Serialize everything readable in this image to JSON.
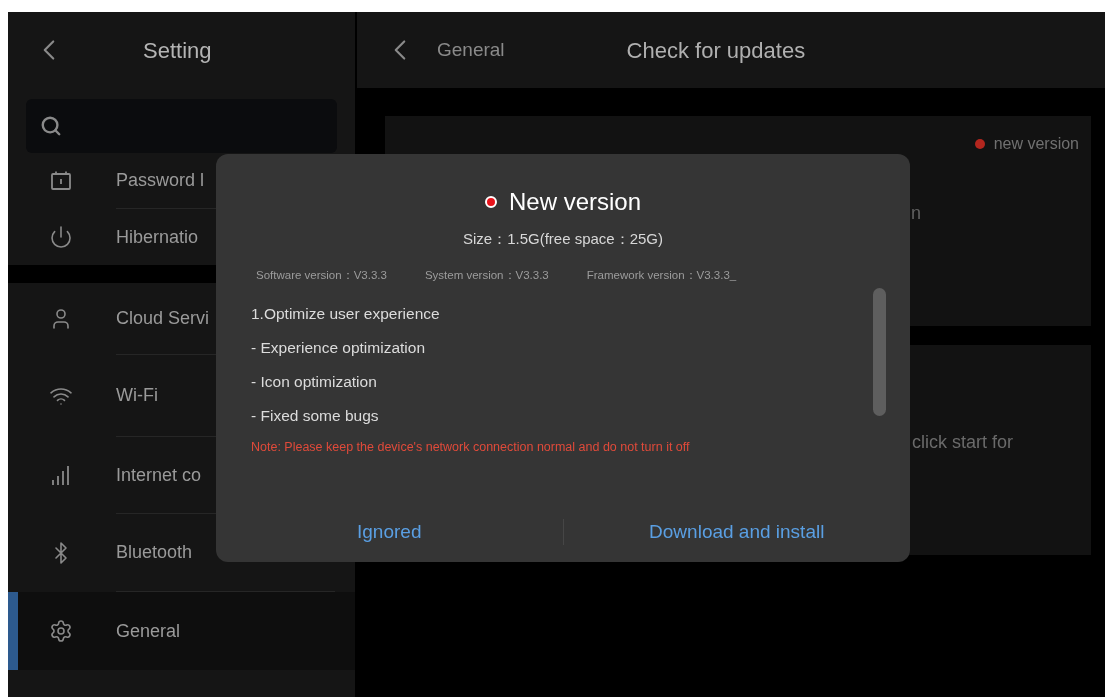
{
  "sidebar": {
    "title": "Setting",
    "groups": [
      [
        {
          "label": "Password l",
          "selected": false
        },
        {
          "label": "Hibernatio",
          "selected": false
        }
      ],
      [
        {
          "label": "Cloud Servi",
          "selected": false
        },
        {
          "label": "Wi-Fi",
          "selected": false
        },
        {
          "label": "Internet co",
          "selected": false
        },
        {
          "label": "Bluetooth",
          "selected": false
        },
        {
          "label": "General",
          "selected": true
        }
      ]
    ]
  },
  "header": {
    "back_label": "General",
    "title": "Check for updates"
  },
  "cards": [
    {
      "status": "new version",
      "color": "#b3261e",
      "text": "n"
    },
    {
      "text": "click start for"
    }
  ],
  "dialog": {
    "title": "New version",
    "color": "#e8131b",
    "size": "Size：1.5G(free space：25G)",
    "versions": [
      "Software version：V3.3.3",
      "System version：V3.3.3",
      "Framework version：V3.3.3_"
    ],
    "notes": [
      "1.Optimize user experience",
      "- Experience optimization",
      "- Icon optimization",
      "- Fixed some bugs"
    ],
    "warning": "Note: Please keep the device's network connection normal and do not turn it off",
    "buttons": [
      "Ignored",
      "Download and install"
    ]
  }
}
